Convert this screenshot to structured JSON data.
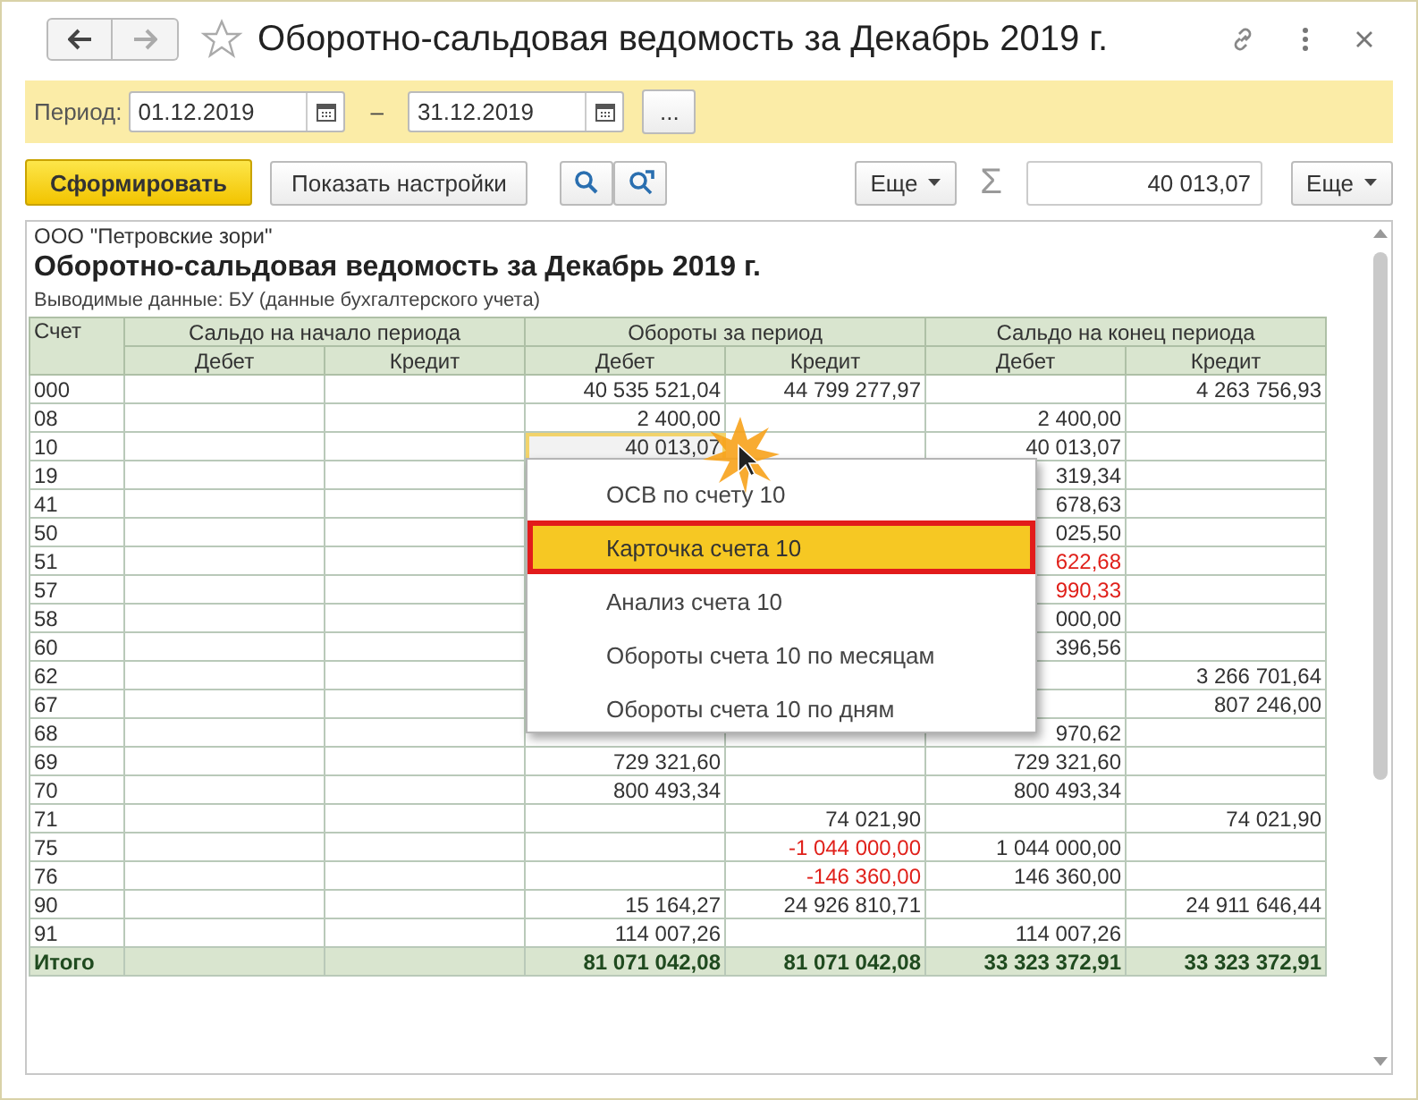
{
  "window": {
    "title": "Оборотно-сальдовая ведомость за Декабрь 2019 г.",
    "favorite": false
  },
  "period": {
    "label": "Период:",
    "from": "01.12.2019",
    "dash": "–",
    "to": "31.12.2019",
    "more_button": "..."
  },
  "toolbar": {
    "generate_button": "Сформировать",
    "settings_button": "Показать настройки",
    "more_button_1": "Еще",
    "sum_symbol": "Σ",
    "sum_value": "40 013,07",
    "more_button_2": "Еще"
  },
  "report": {
    "organization": "ООО \"Петровские зори\"",
    "title": "Оборотно-сальдовая ведомость за Декабрь 2019 г.",
    "output_label": "Выводимые данные:  БУ (данные бухгалтерского учета)",
    "table": {
      "account_header": "Счет",
      "groups": [
        "Сальдо на начало периода",
        "Обороты за период",
        "Сальдо на конец периода"
      ],
      "subheaders": [
        "Дебет",
        "Кредит",
        "Дебет",
        "Кредит",
        "Дебет",
        "Кредит"
      ],
      "rows": [
        {
          "account": "000",
          "cells": [
            null,
            null,
            {
              "text": "40 535 521,04",
              "red": false,
              "selected": false
            },
            {
              "text": "44 799 277,97",
              "red": false,
              "selected": false
            },
            null,
            {
              "text": "4 263 756,93",
              "red": false,
              "selected": false
            }
          ]
        },
        {
          "account": "08",
          "cells": [
            null,
            null,
            {
              "text": "2 400,00",
              "red": false,
              "selected": false
            },
            null,
            {
              "text": "2 400,00",
              "red": false,
              "selected": false
            },
            null
          ]
        },
        {
          "account": "10",
          "cells": [
            null,
            null,
            {
              "text": "40 013,07",
              "red": false,
              "selected": true
            },
            null,
            {
              "text": "40 013,07",
              "red": false,
              "selected": false
            },
            null
          ]
        },
        {
          "account": "19",
          "cells": [
            null,
            null,
            null,
            null,
            {
              "text": "319,34",
              "red": false,
              "selected": false
            },
            null
          ]
        },
        {
          "account": "41",
          "cells": [
            null,
            null,
            null,
            null,
            {
              "text": "678,63",
              "red": false,
              "selected": false
            },
            null
          ]
        },
        {
          "account": "50",
          "cells": [
            null,
            null,
            null,
            null,
            {
              "text": "025,50",
              "red": false,
              "selected": false
            },
            null
          ]
        },
        {
          "account": "51",
          "cells": [
            null,
            null,
            null,
            null,
            {
              "text": "622,68",
              "red": true,
              "selected": false
            },
            null
          ]
        },
        {
          "account": "57",
          "cells": [
            null,
            null,
            null,
            null,
            {
              "text": "990,33",
              "red": true,
              "selected": false
            },
            null
          ]
        },
        {
          "account": "58",
          "cells": [
            null,
            null,
            null,
            null,
            {
              "text": "000,00",
              "red": false,
              "selected": false
            },
            null
          ]
        },
        {
          "account": "60",
          "cells": [
            null,
            null,
            null,
            null,
            {
              "text": "396,56",
              "red": false,
              "selected": false
            },
            null
          ]
        },
        {
          "account": "62",
          "cells": [
            null,
            null,
            null,
            null,
            null,
            {
              "text": "3 266 701,64",
              "red": false,
              "selected": false
            }
          ]
        },
        {
          "account": "67",
          "cells": [
            null,
            null,
            null,
            null,
            null,
            {
              "text": "807 246,00",
              "red": false,
              "selected": false
            }
          ]
        },
        {
          "account": "68",
          "cells": [
            null,
            null,
            null,
            null,
            {
              "text": "970,62",
              "red": false,
              "selected": false
            },
            null
          ]
        },
        {
          "account": "69",
          "cells": [
            null,
            null,
            {
              "text": "729 321,60",
              "red": false,
              "selected": false
            },
            null,
            {
              "text": "729 321,60",
              "red": false,
              "selected": false
            },
            null
          ]
        },
        {
          "account": "70",
          "cells": [
            null,
            null,
            {
              "text": "800 493,34",
              "red": false,
              "selected": false
            },
            null,
            {
              "text": "800 493,34",
              "red": false,
              "selected": false
            },
            null
          ]
        },
        {
          "account": "71",
          "cells": [
            null,
            null,
            null,
            {
              "text": "74 021,90",
              "red": false,
              "selected": false
            },
            null,
            {
              "text": "74 021,90",
              "red": false,
              "selected": false
            }
          ]
        },
        {
          "account": "75",
          "cells": [
            null,
            null,
            null,
            {
              "text": "-1 044 000,00",
              "red": true,
              "selected": false
            },
            {
              "text": "1 044 000,00",
              "red": false,
              "selected": false
            },
            null
          ]
        },
        {
          "account": "76",
          "cells": [
            null,
            null,
            null,
            {
              "text": "-146 360,00",
              "red": true,
              "selected": false
            },
            {
              "text": "146 360,00",
              "red": false,
              "selected": false
            },
            null
          ]
        },
        {
          "account": "90",
          "cells": [
            null,
            null,
            {
              "text": "15 164,27",
              "red": false,
              "selected": false
            },
            {
              "text": "24 926 810,71",
              "red": false,
              "selected": false
            },
            null,
            {
              "text": "24 911 646,44",
              "red": false,
              "selected": false
            }
          ]
        },
        {
          "account": "91",
          "cells": [
            null,
            null,
            {
              "text": "114 007,26",
              "red": false,
              "selected": false
            },
            null,
            {
              "text": "114 007,26",
              "red": false,
              "selected": false
            },
            null
          ]
        }
      ],
      "total": {
        "label": "Итого",
        "cells": [
          null,
          null,
          "81 071 042,08",
          "81 071 042,08",
          "33 323 372,91",
          "33 323 372,91"
        ]
      }
    }
  },
  "context_menu": [
    {
      "label": "ОСВ по счету 10",
      "selected": false
    },
    {
      "label": "Карточка счета 10",
      "selected": true
    },
    {
      "label": "Анализ счета 10",
      "selected": false
    },
    {
      "label": "Обороты счета 10 по месяцам",
      "selected": false
    },
    {
      "label": "Обороты счета 10 по дням",
      "selected": false
    }
  ]
}
